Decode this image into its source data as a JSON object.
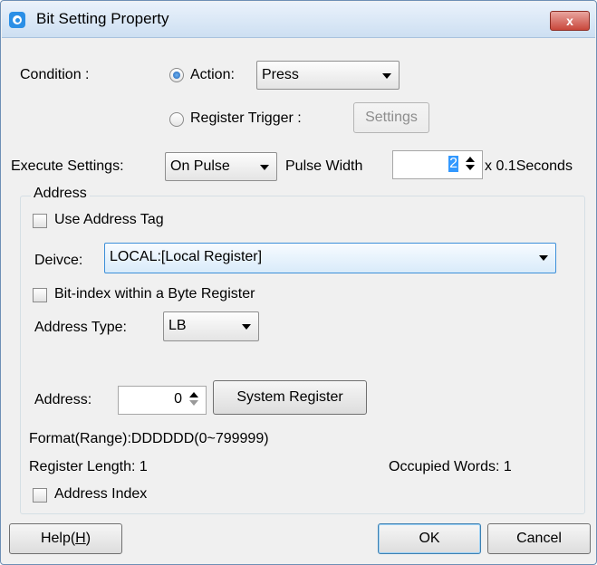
{
  "window": {
    "title": "Bit Setting Property",
    "close_glyph": "x"
  },
  "condition": {
    "label": "Condition :",
    "action_label": "Action:",
    "action_value": "Press",
    "register_trigger_label": "Register Trigger :",
    "settings_button": "Settings"
  },
  "execute": {
    "label": "Execute Settings:",
    "mode_value": "On Pulse",
    "pulse_width_label": "Pulse Width",
    "pulse_width_value": "2",
    "unit": "x 0.1Seconds"
  },
  "address": {
    "group_title": "Address",
    "use_tag_label": "Use Address Tag",
    "device_label": "Deivce:",
    "device_value": "LOCAL:[Local Register]",
    "bit_index_label": "Bit-index within a Byte Register",
    "type_label": "Address Type:",
    "type_value": "LB",
    "address_label": "Address:",
    "address_value": "0",
    "system_register_button": "System Register",
    "format": "Format(Range):DDDDDD(0~799999)",
    "register_length": "Register Length: 1",
    "occupied_words": "Occupied Words: 1",
    "index_label": "Address Index"
  },
  "footer": {
    "help_button": "Help(",
    "help_mnemonic": "H",
    "help_close": ")",
    "ok_button": "OK",
    "cancel_button": "Cancel"
  },
  "colors": {
    "title_bar": "#cddff2",
    "close_button": "#c9473b",
    "selection": "#3399ff",
    "focus_border": "#3c8fd9"
  }
}
